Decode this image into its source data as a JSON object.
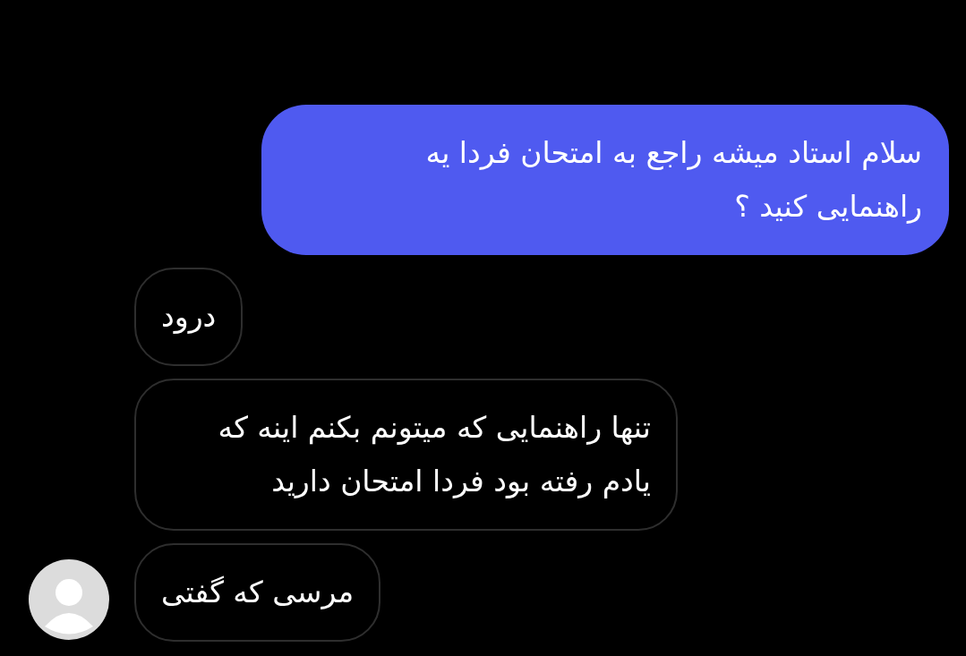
{
  "messages": [
    {
      "kind": "sent",
      "text": "سلام استاد میشه راجع به امتحان فردا یه راهنمایی کنید ؟"
    },
    {
      "kind": "received",
      "text": "درود"
    },
    {
      "kind": "received",
      "text": "تنها راهنمایی که میتونم بکنم اینه که یادم رفته بود فردا امتحان دارید"
    },
    {
      "kind": "received",
      "text": "مرسی که گفتی"
    }
  ]
}
